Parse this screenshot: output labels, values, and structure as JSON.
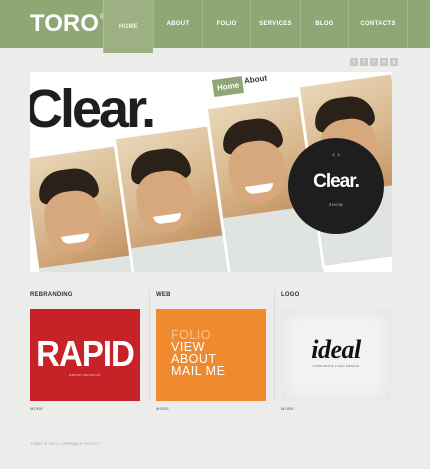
{
  "brand": {
    "logo": "TORO",
    "mark": "®"
  },
  "nav": {
    "items": [
      {
        "label": "HOME",
        "active": true
      },
      {
        "label": "ABOUT"
      },
      {
        "label": "FOLIO"
      },
      {
        "label": "SERVICES"
      },
      {
        "label": "BLOG"
      },
      {
        "label": "CONTACTS"
      }
    ]
  },
  "social_icons": [
    "twitter-icon",
    "facebook-icon",
    "rss-icon",
    "skype-icon",
    "google-icon"
  ],
  "hero": {
    "headline": "Clear.",
    "tag_home": "Home",
    "tag_about": "About",
    "circle_arrows": "‹ ›",
    "circle_word": "Clear.",
    "circle_button": "SHOW"
  },
  "sections": [
    {
      "title": "REBRANDING",
      "card_text": "RAPID",
      "card_small": "BRAND REDESIGN",
      "more": "MORE"
    },
    {
      "title": "WEB",
      "card_lines": [
        "FOLIO",
        "VIEW",
        "ABOUT",
        "MAIL ME"
      ],
      "more": "MORE"
    },
    {
      "title": "LOGO",
      "card_text": "ideal",
      "card_small": "CORPORATE LOGO DESIGN",
      "more": "MORE"
    }
  ],
  "footer": {
    "text": "TORO © 2012 • PRIVACY POLICY"
  },
  "colors": {
    "accent": "#8fa675",
    "red": "#c62228",
    "orange": "#f08a2f"
  }
}
